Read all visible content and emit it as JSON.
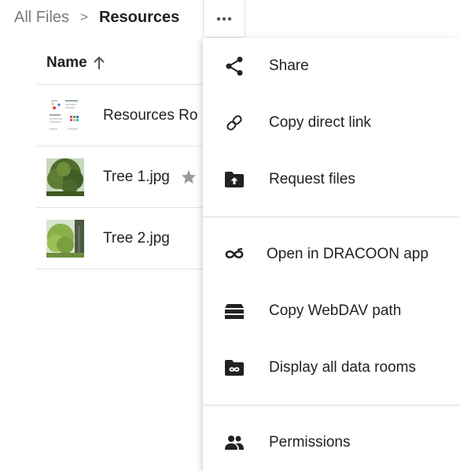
{
  "breadcrumb": {
    "root": "All Files",
    "separator": ">",
    "current": "Resources"
  },
  "more_button": {
    "icon": "more-horizontal-icon"
  },
  "table": {
    "column_name": "Name",
    "sort_icon": "arrow-up-icon",
    "rows": [
      {
        "name": "Resources Ro",
        "thumb": "document-thumbnail",
        "starred": false
      },
      {
        "name": "Tree 1.jpg",
        "thumb": "tree-photo-1",
        "starred": true
      },
      {
        "name": "Tree 2.jpg",
        "thumb": "tree-photo-2",
        "starred": false
      }
    ]
  },
  "menu": {
    "items": [
      {
        "label": "Share",
        "icon": "share-icon"
      },
      {
        "label": "Copy direct link",
        "icon": "link-icon"
      },
      {
        "label": "Request files",
        "icon": "folder-upload-icon"
      },
      {
        "label": "Open in DRACOON app",
        "icon": "dracoon-logo-icon"
      },
      {
        "label": "Copy WebDAV path",
        "icon": "server-stack-icon"
      },
      {
        "label": "Display all data rooms",
        "icon": "data-room-folder-icon"
      },
      {
        "label": "Permissions",
        "icon": "people-icon"
      }
    ]
  }
}
